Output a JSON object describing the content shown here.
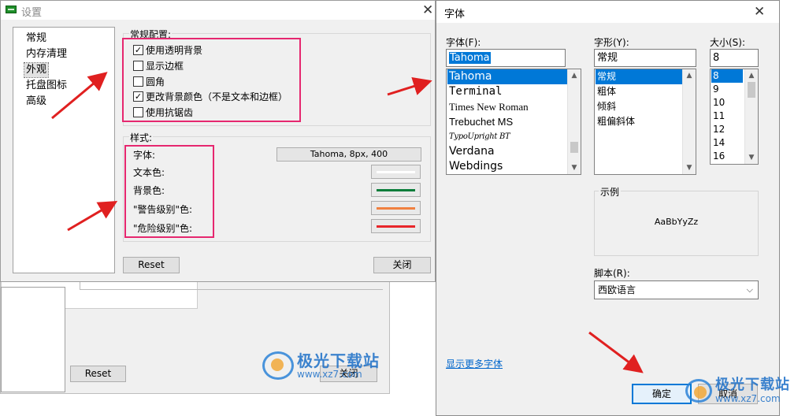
{
  "settings": {
    "title": "设置",
    "nav": [
      "常规",
      "内存清理",
      "外观",
      "托盘图标",
      "高级"
    ],
    "nav_selected": 2,
    "general_group": "常规配置:",
    "checkboxes": [
      {
        "label": "使用透明背景",
        "checked": true
      },
      {
        "label": "显示边框",
        "checked": false
      },
      {
        "label": "圆角",
        "checked": false
      },
      {
        "label": "更改背景颜色（不是文本和边框）",
        "checked": true
      },
      {
        "label": "使用抗锯齿",
        "checked": false
      }
    ],
    "style_group": "样式:",
    "style_rows": {
      "font_label": "字体:",
      "font_value": "Tahoma, 8px, 400",
      "text_color_label": "文本色:",
      "bg_color_label": "背景色:",
      "warn_color_label": "\"警告级别\"色:",
      "danger_color_label": "\"危险级别\"色:"
    },
    "colors": {
      "text": "#ffffff",
      "background": "#0a7d3a",
      "warning": "#f08040",
      "danger": "#e8262a"
    },
    "reset_label": "Reset",
    "close_label": "关闭"
  },
  "background_window": {
    "reset_label": "Reset",
    "close_label": "关闭"
  },
  "font_dialog": {
    "title": "字体",
    "font_label": "字体(F):",
    "font_value": "Tahoma",
    "fonts": [
      "Tahoma",
      "Terminal",
      "Times New Roman",
      "Trebuchet MS",
      "TypoUpright BT",
      "Verdana",
      "Webdings"
    ],
    "style_label": "字形(Y):",
    "style_value": "常规",
    "styles": [
      "常规",
      "粗体",
      "倾斜",
      "粗偏斜体"
    ],
    "size_label": "大小(S):",
    "size_value": "8",
    "sizes": [
      "8",
      "9",
      "10",
      "11",
      "12",
      "14",
      "16"
    ],
    "sample_label": "示例",
    "sample_text": "AaBbYyZz",
    "script_label": "脚本(R):",
    "script_value": "西欧语言",
    "more_fonts_link": "显示更多字体",
    "ok_label": "确定",
    "cancel_label": "取消"
  },
  "watermark": {
    "name": "极光下载站",
    "url": "www.xz7.com"
  },
  "accent": {
    "highlight_box": "#e6276f",
    "arrow": "#e02020",
    "selection": "#0078d7"
  }
}
